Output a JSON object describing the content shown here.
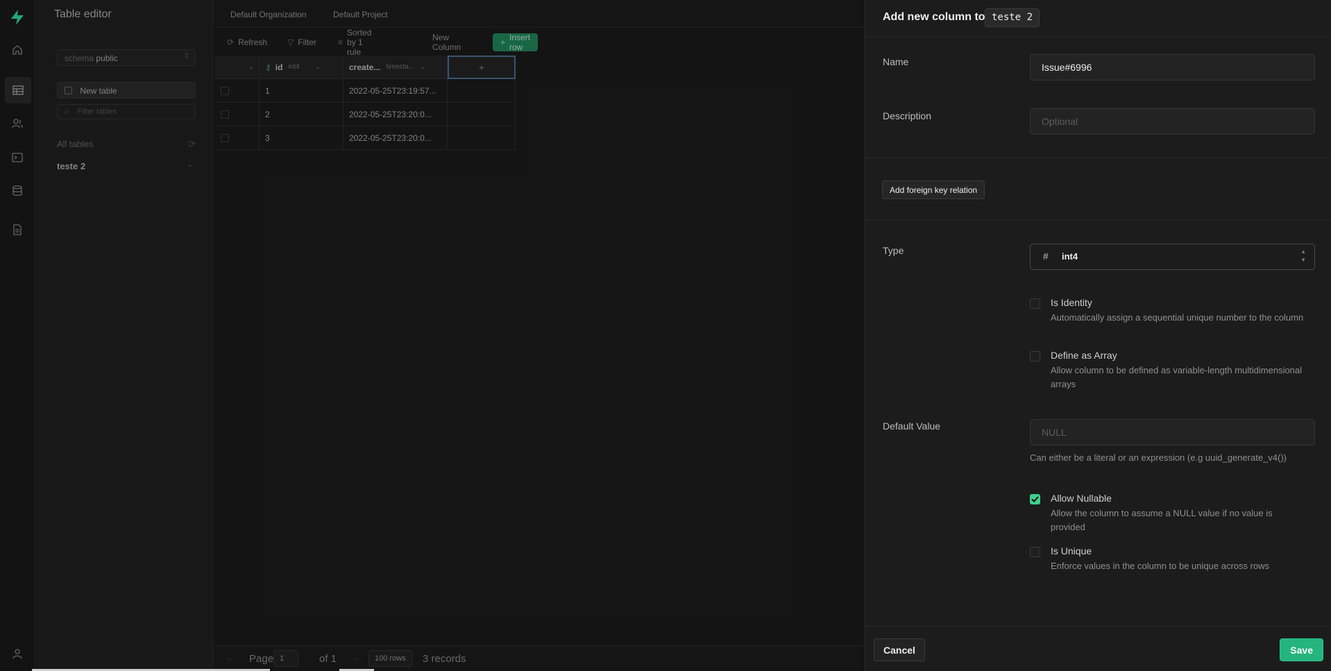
{
  "app": {
    "section_title": "Table editor"
  },
  "rail": {
    "icons": [
      "bolt-logo-icon",
      "home-icon",
      "table-icon",
      "users-icon",
      "terminal-icon",
      "database-icon",
      "document-icon",
      "user-icon"
    ]
  },
  "sidebar": {
    "schema_label": "schema",
    "schema_value": "public",
    "new_table_label": "New table",
    "filter_placeholder": "Filter tables",
    "all_tables_label": "All tables",
    "tables": [
      {
        "label": "teste 2"
      }
    ]
  },
  "breadcrumb": {
    "org": "Default Organization",
    "project": "Default Project"
  },
  "toolbar": {
    "refresh": "Refresh",
    "filter": "Filter",
    "sorted": "Sorted by 1 rule",
    "new_column": "New Column",
    "insert_row": "Insert row"
  },
  "grid": {
    "columns": [
      {
        "name": "id",
        "type": "int4"
      },
      {
        "name": "create...",
        "type": "timesta..."
      }
    ],
    "add_column_glyph": "+",
    "rows": [
      {
        "id": "1",
        "created": "2022-05-25T23:19:57..."
      },
      {
        "id": "2",
        "created": "2022-05-25T23:20:0..."
      },
      {
        "id": "3",
        "created": "2022-05-25T23:20:0..."
      }
    ]
  },
  "pagination": {
    "page_label": "Page",
    "page_value": "1",
    "of_label": "of 1",
    "rows_label": "100 rows",
    "records_label": "3 records"
  },
  "sheet": {
    "title": "Add new column to",
    "table_name": "teste 2",
    "name_label": "Name",
    "name_value": "Issue#6996",
    "description_label": "Description",
    "description_placeholder": "Optional",
    "fk_button": "Add foreign key relation",
    "type_label": "Type",
    "type_value": "int4",
    "type_icon": "#",
    "options": [
      {
        "title": "Is Identity",
        "desc": "Automatically assign a sequential unique number to the column",
        "checked": false
      },
      {
        "title": "Define as Array",
        "desc": "Allow column to be defined as variable-length multidimensional arrays",
        "checked": false
      },
      {
        "title": "Allow Nullable",
        "desc": "Allow the column to assume a NULL value if no value is provided",
        "checked": true
      },
      {
        "title": "Is Unique",
        "desc": "Enforce values in the column to be unique across rows",
        "checked": false
      }
    ],
    "default_label": "Default Value",
    "default_placeholder": "NULL",
    "default_hint": "Can either be a literal or an expression (e.g uuid_generate_v4())",
    "cancel": "Cancel",
    "save": "Save"
  },
  "colors": {
    "accent": "#3ecf8e",
    "save_bg": "#24b47e",
    "insert_bg": "#1b6d4a"
  }
}
